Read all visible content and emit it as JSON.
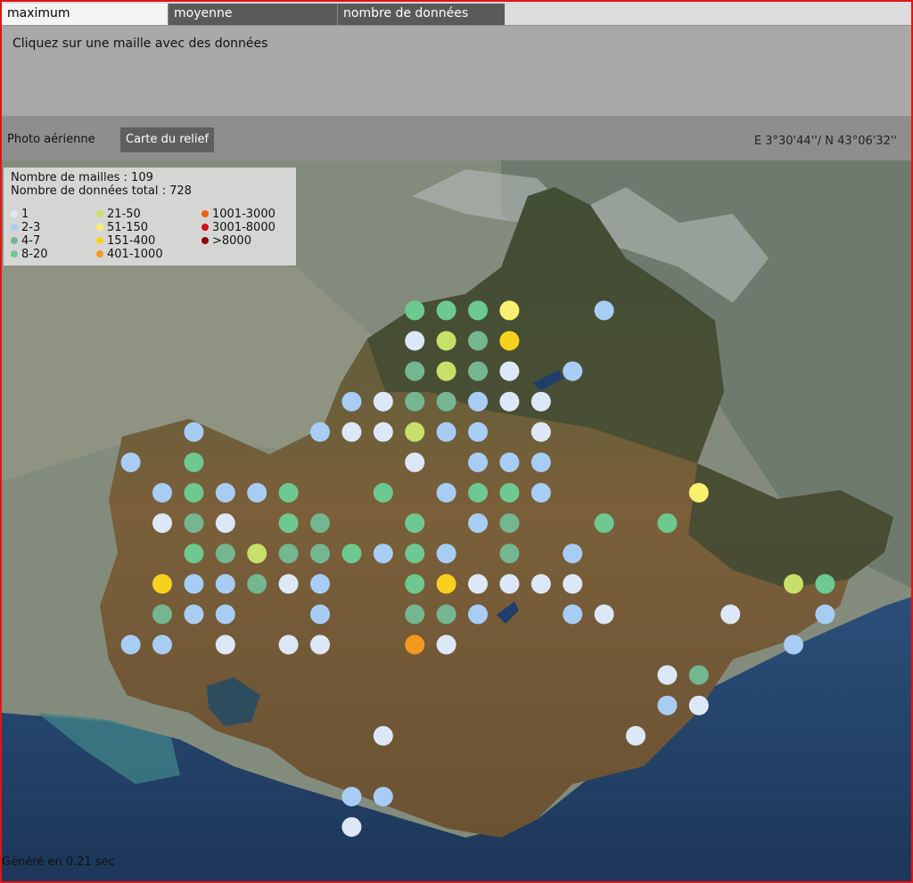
{
  "tabs": [
    {
      "label": "maximum",
      "active": true
    },
    {
      "label": "moyenne",
      "active": false
    },
    {
      "label": "nombre de données",
      "active": false
    }
  ],
  "info": {
    "message": "Cliquez sur une maille avec des données"
  },
  "toolbar": {
    "photo_label": "Photo aérienne",
    "relief_label": "Carte du relief",
    "coordinates": "E 3°30'44''/ N 43°06'32''"
  },
  "legend": {
    "cells_text": "Nombre de mailles : 109",
    "total_text": "Nombre de données total : 728",
    "classes": [
      {
        "label": "1",
        "color": "#dce8f7"
      },
      {
        "label": "2-3",
        "color": "#a8cdf5"
      },
      {
        "label": "4-7",
        "color": "#74b690"
      },
      {
        "label": "8-20",
        "color": "#6ec990"
      },
      {
        "label": "21-50",
        "color": "#c6e06a"
      },
      {
        "label": "51-150",
        "color": "#f8f06e"
      },
      {
        "label": "151-400",
        "color": "#f6d21e"
      },
      {
        "label": "401-1000",
        "color": "#f29a20"
      },
      {
        "label": "1001-3000",
        "color": "#f06010"
      },
      {
        "label": "3001-8000",
        "color": "#d01010"
      },
      {
        "label": ">8000",
        "color": "#900808"
      }
    ]
  },
  "grid_cells": [
    {
      "col": 13,
      "row": 4,
      "cls": 3
    },
    {
      "col": 14,
      "row": 4,
      "cls": 3
    },
    {
      "col": 15,
      "row": 4,
      "cls": 3
    },
    {
      "col": 16,
      "row": 4,
      "cls": 5
    },
    {
      "col": 19,
      "row": 4,
      "cls": 1
    },
    {
      "col": 13,
      "row": 5,
      "cls": 0
    },
    {
      "col": 14,
      "row": 5,
      "cls": 4
    },
    {
      "col": 15,
      "row": 5,
      "cls": 2
    },
    {
      "col": 16,
      "row": 5,
      "cls": 6
    },
    {
      "col": 13,
      "row": 6,
      "cls": 2
    },
    {
      "col": 14,
      "row": 6,
      "cls": 4
    },
    {
      "col": 15,
      "row": 6,
      "cls": 2
    },
    {
      "col": 16,
      "row": 6,
      "cls": 0
    },
    {
      "col": 18,
      "row": 6,
      "cls": 1
    },
    {
      "col": 11,
      "row": 7,
      "cls": 1
    },
    {
      "col": 12,
      "row": 7,
      "cls": 0
    },
    {
      "col": 13,
      "row": 7,
      "cls": 2
    },
    {
      "col": 14,
      "row": 7,
      "cls": 2
    },
    {
      "col": 15,
      "row": 7,
      "cls": 1
    },
    {
      "col": 16,
      "row": 7,
      "cls": 0
    },
    {
      "col": 17,
      "row": 7,
      "cls": 0
    },
    {
      "col": 6,
      "row": 8,
      "cls": 1
    },
    {
      "col": 10,
      "row": 8,
      "cls": 1
    },
    {
      "col": 11,
      "row": 8,
      "cls": 0
    },
    {
      "col": 12,
      "row": 8,
      "cls": 0
    },
    {
      "col": 13,
      "row": 8,
      "cls": 4
    },
    {
      "col": 14,
      "row": 8,
      "cls": 1
    },
    {
      "col": 15,
      "row": 8,
      "cls": 1
    },
    {
      "col": 17,
      "row": 8,
      "cls": 0
    },
    {
      "col": 4,
      "row": 9,
      "cls": 1
    },
    {
      "col": 6,
      "row": 9,
      "cls": 3
    },
    {
      "col": 13,
      "row": 9,
      "cls": 0
    },
    {
      "col": 15,
      "row": 9,
      "cls": 1
    },
    {
      "col": 16,
      "row": 9,
      "cls": 1
    },
    {
      "col": 17,
      "row": 9,
      "cls": 1
    },
    {
      "col": 5,
      "row": 10,
      "cls": 1
    },
    {
      "col": 6,
      "row": 10,
      "cls": 3
    },
    {
      "col": 7,
      "row": 10,
      "cls": 1
    },
    {
      "col": 8,
      "row": 10,
      "cls": 1
    },
    {
      "col": 9,
      "row": 10,
      "cls": 3
    },
    {
      "col": 12,
      "row": 10,
      "cls": 3
    },
    {
      "col": 14,
      "row": 10,
      "cls": 1
    },
    {
      "col": 15,
      "row": 10,
      "cls": 3
    },
    {
      "col": 16,
      "row": 10,
      "cls": 3
    },
    {
      "col": 17,
      "row": 10,
      "cls": 1
    },
    {
      "col": 22,
      "row": 10,
      "cls": 5
    },
    {
      "col": 5,
      "row": 11,
      "cls": 0
    },
    {
      "col": 6,
      "row": 11,
      "cls": 2
    },
    {
      "col": 7,
      "row": 11,
      "cls": 0
    },
    {
      "col": 9,
      "row": 11,
      "cls": 3
    },
    {
      "col": 10,
      "row": 11,
      "cls": 2
    },
    {
      "col": 13,
      "row": 11,
      "cls": 3
    },
    {
      "col": 15,
      "row": 11,
      "cls": 1
    },
    {
      "col": 16,
      "row": 11,
      "cls": 2
    },
    {
      "col": 19,
      "row": 11,
      "cls": 3
    },
    {
      "col": 21,
      "row": 11,
      "cls": 3
    },
    {
      "col": 6,
      "row": 12,
      "cls": 3
    },
    {
      "col": 7,
      "row": 12,
      "cls": 2
    },
    {
      "col": 8,
      "row": 12,
      "cls": 4
    },
    {
      "col": 9,
      "row": 12,
      "cls": 2
    },
    {
      "col": 10,
      "row": 12,
      "cls": 2
    },
    {
      "col": 11,
      "row": 12,
      "cls": 3
    },
    {
      "col": 12,
      "row": 12,
      "cls": 1
    },
    {
      "col": 13,
      "row": 12,
      "cls": 3
    },
    {
      "col": 14,
      "row": 12,
      "cls": 1
    },
    {
      "col": 16,
      "row": 12,
      "cls": 2
    },
    {
      "col": 18,
      "row": 12,
      "cls": 1
    },
    {
      "col": 5,
      "row": 13,
      "cls": 6
    },
    {
      "col": 6,
      "row": 13,
      "cls": 1
    },
    {
      "col": 7,
      "row": 13,
      "cls": 1
    },
    {
      "col": 8,
      "row": 13,
      "cls": 2
    },
    {
      "col": 9,
      "row": 13,
      "cls": 0
    },
    {
      "col": 10,
      "row": 13,
      "cls": 1
    },
    {
      "col": 13,
      "row": 13,
      "cls": 3
    },
    {
      "col": 14,
      "row": 13,
      "cls": 6
    },
    {
      "col": 15,
      "row": 13,
      "cls": 0
    },
    {
      "col": 16,
      "row": 13,
      "cls": 0
    },
    {
      "col": 17,
      "row": 13,
      "cls": 0
    },
    {
      "col": 18,
      "row": 13,
      "cls": 0
    },
    {
      "col": 25,
      "row": 13,
      "cls": 4
    },
    {
      "col": 26,
      "row": 13,
      "cls": 3
    },
    {
      "col": 5,
      "row": 14,
      "cls": 2
    },
    {
      "col": 6,
      "row": 14,
      "cls": 1
    },
    {
      "col": 7,
      "row": 14,
      "cls": 1
    },
    {
      "col": 10,
      "row": 14,
      "cls": 1
    },
    {
      "col": 13,
      "row": 14,
      "cls": 2
    },
    {
      "col": 14,
      "row": 14,
      "cls": 2
    },
    {
      "col": 15,
      "row": 14,
      "cls": 1
    },
    {
      "col": 18,
      "row": 14,
      "cls": 1
    },
    {
      "col": 19,
      "row": 14,
      "cls": 0
    },
    {
      "col": 23,
      "row": 14,
      "cls": 0
    },
    {
      "col": 26,
      "row": 14,
      "cls": 1
    },
    {
      "col": 4,
      "row": 15,
      "cls": 1
    },
    {
      "col": 5,
      "row": 15,
      "cls": 1
    },
    {
      "col": 7,
      "row": 15,
      "cls": 0
    },
    {
      "col": 9,
      "row": 15,
      "cls": 0
    },
    {
      "col": 10,
      "row": 15,
      "cls": 0
    },
    {
      "col": 13,
      "row": 15,
      "cls": 7
    },
    {
      "col": 14,
      "row": 15,
      "cls": 0
    },
    {
      "col": 25,
      "row": 15,
      "cls": 1
    },
    {
      "col": 21,
      "row": 16,
      "cls": 0
    },
    {
      "col": 22,
      "row": 16,
      "cls": 2
    },
    {
      "col": 21,
      "row": 17,
      "cls": 1
    },
    {
      "col": 22,
      "row": 17,
      "cls": 0
    },
    {
      "col": 12,
      "row": 18,
      "cls": 0
    },
    {
      "col": 20,
      "row": 18,
      "cls": 0
    },
    {
      "col": 11,
      "row": 20,
      "cls": 1
    },
    {
      "col": 12,
      "row": 20,
      "cls": 1
    },
    {
      "col": 11,
      "row": 21,
      "cls": 0
    }
  ],
  "footer": {
    "text": "Généré en 0.21 sec"
  }
}
